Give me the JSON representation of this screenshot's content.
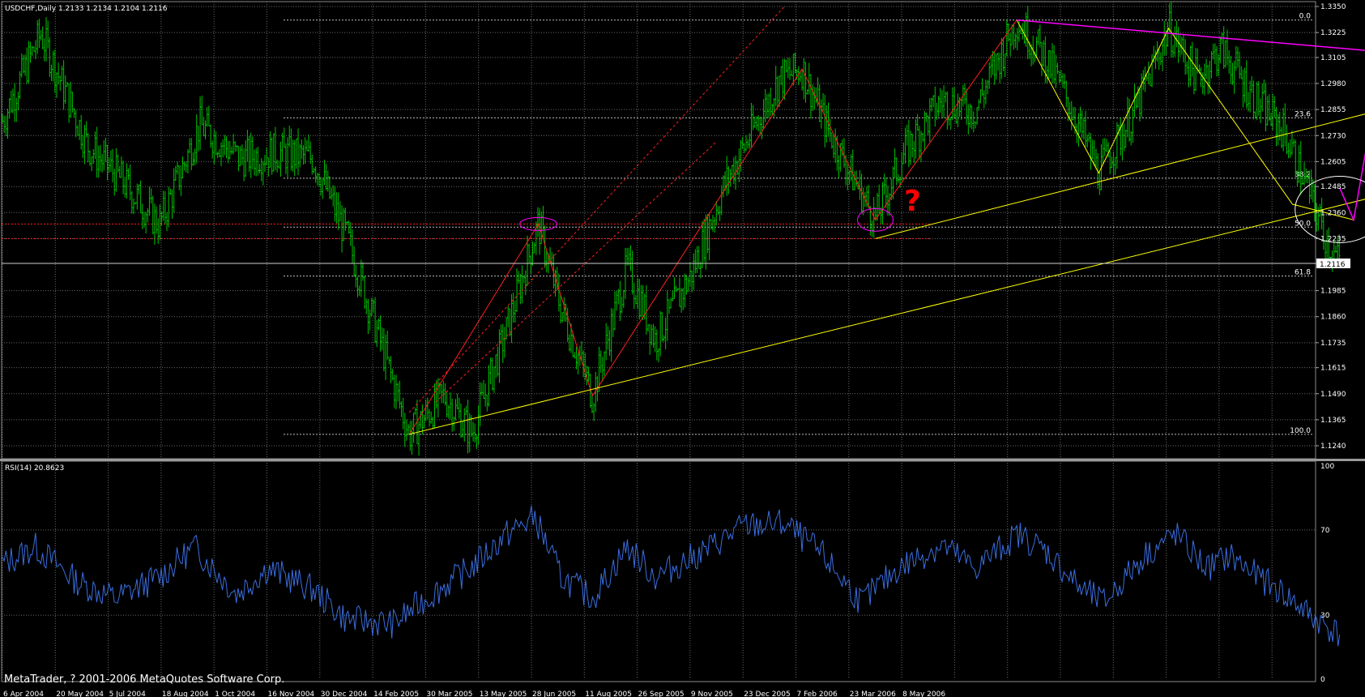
{
  "app": {
    "symbol_info": "USDCHF,Daily  1.2133 1.2134 1.2104 1.2116",
    "rsi_info": "RSI(14) 20.8623",
    "copyright": "MetaTrader, ? 2001-2006 MetaQuotes Software Corp.",
    "question_mark": "?"
  },
  "colors": {
    "background": "#000000",
    "grid": "#6a6a6a",
    "price_bars": "#00c400",
    "rsi_line": "#3a6ee0",
    "trend_lines": "#ffff00",
    "zigzag": "#ff2020",
    "target_line": "#ff00ff",
    "question": "#ff0000",
    "text": "#ffffff"
  },
  "chart_data": [
    {
      "type": "ohlc",
      "symbol": "USDCHF",
      "timeframe": "Daily",
      "last": 1.2116,
      "ylim": [
        1.124,
        1.335
      ],
      "y_ticks": [
        "1.3350",
        "1.3225",
        "1.3105",
        "1.2980",
        "1.2855",
        "1.2730",
        "1.2605",
        "1.2485",
        "1.2360",
        "1.2235",
        "1.2116",
        "1.1985",
        "1.1860",
        "1.1735",
        "1.1615",
        "1.1490",
        "1.1365",
        "1.1240"
      ],
      "x_ticks": [
        "6 Apr 2004",
        "20 May 2004",
        "5 Jul 2004",
        "18 Aug 2004",
        "1 Oct 2004",
        "16 Nov 2004",
        "30 Dec 2004",
        "14 Feb 2005",
        "30 Mar 2005",
        "13 May 2005",
        "28 Jun 2005",
        "11 Aug 2005",
        "26 Sep 2005",
        "9 Nov 2005",
        "23 Dec 2005",
        "7 Feb 2006",
        "23 Mar 2006",
        "8 May 2006"
      ],
      "fibonacci_levels": [
        {
          "label": "0.0",
          "price": 1.3285
        },
        {
          "label": "23.6",
          "price": 1.2815
        },
        {
          "label": "38.2",
          "price": 1.2525
        },
        {
          "label": "50.0",
          "price": 1.229
        },
        {
          "label": "61.8",
          "price": 1.2055
        },
        {
          "label": "100.0",
          "price": 1.1295
        }
      ],
      "swing_points": [
        {
          "date": "2004-04-06",
          "price": 1.28
        },
        {
          "date": "2004-04-28",
          "price": 1.322
        },
        {
          "date": "2004-05-25",
          "price": 1.268
        },
        {
          "date": "2004-06-15",
          "price": 1.25
        },
        {
          "date": "2004-07-05",
          "price": 1.23
        },
        {
          "date": "2004-07-28",
          "price": 1.278
        },
        {
          "date": "2004-08-20",
          "price": 1.262
        },
        {
          "date": "2004-09-10",
          "price": 1.265
        },
        {
          "date": "2004-10-01",
          "price": 1.262
        },
        {
          "date": "2004-10-20",
          "price": 1.225
        },
        {
          "date": "2004-11-10",
          "price": 1.17
        },
        {
          "date": "2004-11-25",
          "price": 1.1295
        },
        {
          "date": "2004-12-15",
          "price": 1.148
        },
        {
          "date": "2004-12-31",
          "price": 1.13
        },
        {
          "date": "2005-01-20",
          "price": 1.18
        },
        {
          "date": "2005-02-07",
          "price": 1.2305
        },
        {
          "date": "2005-02-20",
          "price": 1.19
        },
        {
          "date": "2005-03-10",
          "price": 1.148
        },
        {
          "date": "2005-03-30",
          "price": 1.21
        },
        {
          "date": "2005-04-15",
          "price": 1.175
        },
        {
          "date": "2005-05-05",
          "price": 1.205
        },
        {
          "date": "2005-05-25",
          "price": 1.25
        },
        {
          "date": "2005-06-25",
          "price": 1.3
        },
        {
          "date": "2005-07-08",
          "price": 1.305
        },
        {
          "date": "2005-07-25",
          "price": 1.272
        },
        {
          "date": "2005-08-19",
          "price": 1.233
        },
        {
          "date": "2005-09-05",
          "price": 1.265
        },
        {
          "date": "2005-09-26",
          "price": 1.29
        },
        {
          "date": "2005-10-15",
          "price": 1.285
        },
        {
          "date": "2005-11-08",
          "price": 1.3285
        },
        {
          "date": "2005-11-25",
          "price": 1.31
        },
        {
          "date": "2005-12-10",
          "price": 1.285
        },
        {
          "date": "2005-12-25",
          "price": 1.255
        },
        {
          "date": "2006-01-15",
          "price": 1.285
        },
        {
          "date": "2006-02-03",
          "price": 1.3245
        },
        {
          "date": "2006-02-20",
          "price": 1.3
        },
        {
          "date": "2006-03-05",
          "price": 1.315
        },
        {
          "date": "2006-03-25",
          "price": 1.29
        },
        {
          "date": "2006-04-10",
          "price": 1.275
        },
        {
          "date": "2006-04-25",
          "price": 1.245
        },
        {
          "date": "2006-05-05",
          "price": 1.222
        },
        {
          "date": "2006-05-12",
          "price": 1.2116
        }
      ]
    },
    {
      "type": "line",
      "name": "RSI(14)",
      "last": 20.8623,
      "ylim": [
        0,
        100
      ],
      "y_ticks": [
        "100",
        "70",
        "30",
        "0"
      ],
      "levels": [
        70,
        30
      ],
      "points": [
        {
          "date": "2004-04-06",
          "value": 54
        },
        {
          "date": "2004-04-25",
          "value": 62
        },
        {
          "date": "2004-05-20",
          "value": 45
        },
        {
          "date": "2004-06-10",
          "value": 38
        },
        {
          "date": "2004-07-05",
          "value": 48
        },
        {
          "date": "2004-07-25",
          "value": 62
        },
        {
          "date": "2004-08-18",
          "value": 40
        },
        {
          "date": "2004-09-05",
          "value": 52
        },
        {
          "date": "2004-10-01",
          "value": 42
        },
        {
          "date": "2004-10-20",
          "value": 28
        },
        {
          "date": "2004-11-16",
          "value": 26
        },
        {
          "date": "2004-12-05",
          "value": 38
        },
        {
          "date": "2004-12-30",
          "value": 52
        },
        {
          "date": "2005-01-20",
          "value": 68
        },
        {
          "date": "2005-02-05",
          "value": 76
        },
        {
          "date": "2005-02-20",
          "value": 48
        },
        {
          "date": "2005-03-10",
          "value": 38
        },
        {
          "date": "2005-03-30",
          "value": 62
        },
        {
          "date": "2005-04-15",
          "value": 48
        },
        {
          "date": "2005-05-13",
          "value": 60
        },
        {
          "date": "2005-06-05",
          "value": 72
        },
        {
          "date": "2005-06-28",
          "value": 73
        },
        {
          "date": "2005-07-20",
          "value": 58
        },
        {
          "date": "2005-08-11",
          "value": 36
        },
        {
          "date": "2005-09-01",
          "value": 52
        },
        {
          "date": "2005-09-26",
          "value": 63
        },
        {
          "date": "2005-10-15",
          "value": 52
        },
        {
          "date": "2005-11-09",
          "value": 68
        },
        {
          "date": "2005-11-25",
          "value": 60
        },
        {
          "date": "2005-12-15",
          "value": 42
        },
        {
          "date": "2005-12-28",
          "value": 36
        },
        {
          "date": "2006-01-20",
          "value": 58
        },
        {
          "date": "2006-02-07",
          "value": 68
        },
        {
          "date": "2006-02-25",
          "value": 52
        },
        {
          "date": "2006-03-10",
          "value": 58
        },
        {
          "date": "2006-03-23",
          "value": 50
        },
        {
          "date": "2006-04-10",
          "value": 40
        },
        {
          "date": "2006-04-25",
          "value": 30
        },
        {
          "date": "2006-05-12",
          "value": 20.86
        }
      ]
    }
  ],
  "annotations": {
    "support_line": {
      "from": {
        "date": "2004-11-25",
        "price": 1.1295
      },
      "to": {
        "date": "2006-06-25",
        "price": 1.2485
      }
    },
    "upper_channel": {
      "from": {
        "date": "2005-08-19",
        "price": 1.2235
      },
      "to": {
        "date": "2006-06-15",
        "price": 1.2875
      }
    },
    "zigzag_yellow": [
      {
        "date": "2005-11-08",
        "price": 1.3285
      },
      {
        "date": "2005-12-25",
        "price": 1.255
      },
      {
        "date": "2006-02-03",
        "price": 1.3245
      },
      {
        "date": "2006-04-15",
        "price": 1.24
      },
      {
        "date": "2006-05-20",
        "price": 1.2325
      }
    ],
    "zigzag_red": [
      {
        "date": "2004-11-25",
        "price": 1.1295
      },
      {
        "date": "2005-02-07",
        "price": 1.2305
      },
      {
        "date": "2005-03-10",
        "price": 1.148
      },
      {
        "date": "2005-07-08",
        "price": 1.305
      },
      {
        "date": "2005-08-19",
        "price": 1.2325
      },
      {
        "date": "2005-11-08",
        "price": 1.3285
      }
    ],
    "dotted_red_channel": [
      {
        "from": {
          "date": "2004-11-25",
          "price": 1.14
        },
        "to": {
          "date": "2005-06-28",
          "price": 1.335
        }
      },
      {
        "from": {
          "date": "2004-12-10",
          "price": 1.145
        },
        "to": {
          "date": "2005-05-20",
          "price": 1.27
        }
      }
    ],
    "resistance_red_dotted": [
      1.2305,
      1.2235
    ],
    "magenta_downtrend": {
      "from": {
        "date": "2005-11-08",
        "price": 1.3285
      },
      "to": {
        "date": "2006-06-15",
        "price": 1.3125
      }
    },
    "magenta_projection": [
      {
        "date": "2006-05-12",
        "price": 1.248
      },
      {
        "date": "2006-05-20",
        "price": 1.2325
      },
      {
        "date": "2006-05-30",
        "price": 1.28
      }
    ]
  }
}
